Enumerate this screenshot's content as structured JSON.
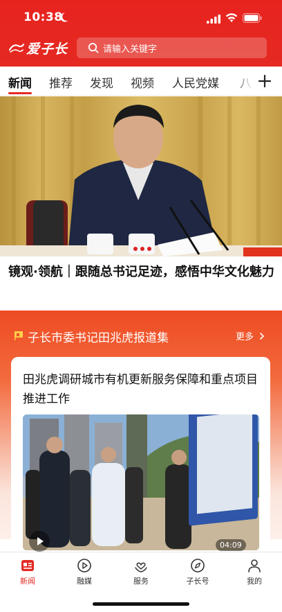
{
  "status_bar": {
    "time": "10:38"
  },
  "header": {
    "logo_text": "爱子长",
    "search_placeholder": "请输入关键字"
  },
  "tabs": [
    {
      "label": "新闻",
      "active": true
    },
    {
      "label": "推荐"
    },
    {
      "label": "发现"
    },
    {
      "label": "视频"
    },
    {
      "label": "人民党媒"
    },
    {
      "label": "八"
    }
  ],
  "hero": {
    "title": "镜观·领航｜跟随总书记足迹，感悟中华文化魅力"
  },
  "feature": {
    "section_title": "子长市委书记田兆虎报道集",
    "more_label": "更多",
    "card_title": "田兆虎调研城市有机更新服务保障和重点项目推进工作",
    "video_duration": "04:09"
  },
  "bottom_nav": [
    {
      "label": "新闻",
      "icon": "news-icon",
      "active": true
    },
    {
      "label": "融媒",
      "icon": "play-circle-icon"
    },
    {
      "label": "服务",
      "icon": "heart-hands-icon"
    },
    {
      "label": "子长号",
      "icon": "compass-icon"
    },
    {
      "label": "我的",
      "icon": "person-icon"
    }
  ],
  "colors": {
    "brand_red": "#e42a22",
    "band_orange": "#ee4b22"
  }
}
